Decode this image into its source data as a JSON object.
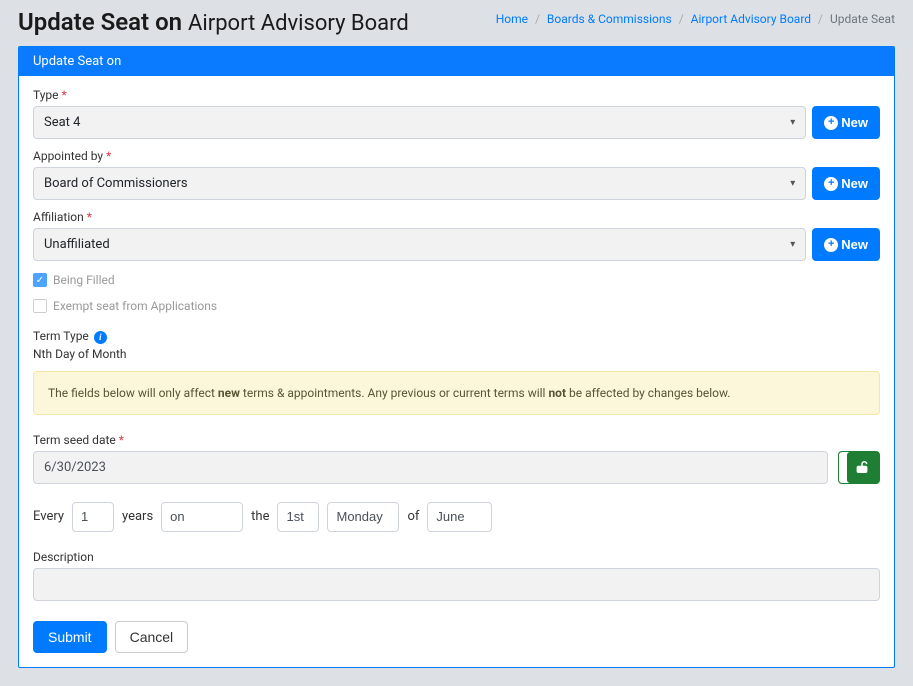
{
  "header": {
    "title_prefix": "Update Seat on ",
    "title_board": "Airport Advisory Board"
  },
  "breadcrumb": {
    "home": "Home",
    "boards": "Boards & Commissions",
    "board_name": "Airport Advisory Board",
    "current": "Update Seat"
  },
  "card": {
    "header": "Update Seat on"
  },
  "fields": {
    "type": {
      "label": "Type",
      "value": "Seat 4",
      "new_btn": "New"
    },
    "appointed_by": {
      "label": "Appointed by",
      "value": "Board of Commissioners",
      "new_btn": "New"
    },
    "affiliation": {
      "label": "Affiliation",
      "value": "Unaffiliated",
      "new_btn": "New"
    },
    "being_filled": {
      "label": "Being Filled"
    },
    "exempt": {
      "label": "Exempt seat from Applications"
    },
    "term_type": {
      "label": "Term Type",
      "value": "Nth Day of Month"
    },
    "warning": {
      "pre": "The fields below will only affect ",
      "bold1": "new",
      "mid": " terms & appointments. Any previous or current terms will ",
      "bold2": "not",
      "post": " be affected by changes below."
    },
    "seed_date": {
      "label": "Term seed date",
      "value": "6/30/2023"
    },
    "schedule": {
      "every": "Every",
      "num": "1",
      "years": "years",
      "on": "on",
      "the": "the",
      "nth": "1st",
      "day": "Monday",
      "of": "of",
      "month": "June"
    },
    "description": {
      "label": "Description"
    }
  },
  "buttons": {
    "submit": "Submit",
    "cancel": "Cancel"
  }
}
